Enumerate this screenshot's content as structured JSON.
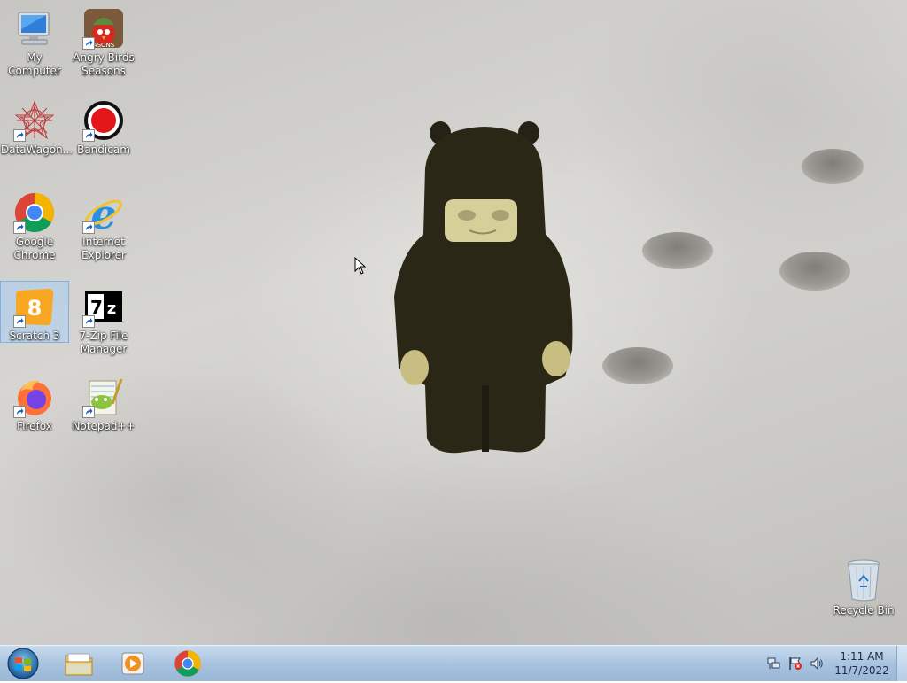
{
  "desktop_icons": [
    {
      "label": "My Computer",
      "icon": "computer-icon"
    },
    {
      "label": "Angry Birds Seasons",
      "icon": "angry-birds-icon"
    },
    {
      "label": "DataWagon...",
      "icon": "datawagon-icon"
    },
    {
      "label": "Bandicam",
      "icon": "bandicam-icon"
    },
    {
      "label": "Google Chrome",
      "icon": "chrome-icon"
    },
    {
      "label": "Internet Explorer",
      "icon": "internet-explorer-icon"
    },
    {
      "label": "Scratch 3",
      "icon": "scratch-icon",
      "selected": true
    },
    {
      "label": "7-Zip File Manager",
      "icon": "7zip-icon"
    },
    {
      "label": "Firefox",
      "icon": "firefox-icon"
    },
    {
      "label": "Notepad++",
      "icon": "notepadpp-icon"
    }
  ],
  "recycle_bin": {
    "label": "Recycle Bin",
    "icon": "recycle-bin-icon"
  },
  "taskbar": {
    "start_icon": "windows-start-icon",
    "pinned": [
      {
        "name": "Windows Explorer",
        "icon": "folder-icon"
      },
      {
        "name": "Windows Media Player",
        "icon": "media-player-icon"
      },
      {
        "name": "Google Chrome",
        "icon": "chrome-icon"
      }
    ],
    "tray": {
      "icons": [
        "network-icon",
        "action-center-flag-icon",
        "volume-icon"
      ],
      "time": "1:11 AM",
      "date": "11/7/2022"
    }
  },
  "colors": {
    "taskbar": "#a9c3df",
    "wallpaper": "#cfcecb",
    "selection": "#aacdf5"
  }
}
